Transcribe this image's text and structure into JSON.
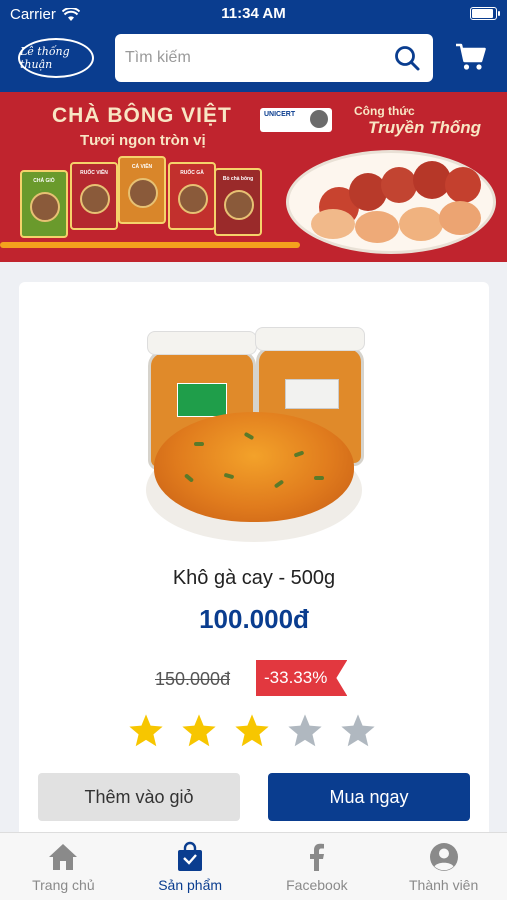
{
  "status_bar": {
    "carrier": "Carrier",
    "time": "11:34 AM",
    "battery_level": 0.95
  },
  "header": {
    "logo_text": "Lê thống thuận",
    "search_placeholder": "Tìm kiếm",
    "icons": {
      "search": "search-icon",
      "cart": "cart-icon"
    }
  },
  "banner": {
    "title": "CHÀ BÔNG VIỆT",
    "subtitle": "Tươi ngon tròn vị",
    "cert_label": "UNICERT",
    "tagline_top": "Công thức",
    "tagline_main": "Truyền Thống",
    "packs": [
      "CHẢ GIÒ",
      "RUỐC VIÊN",
      "CÁ VIÊN",
      "RUỐC GÀ",
      "Bò chà bông"
    ]
  },
  "product": {
    "name": "Khô gà cay - 500g",
    "price": "100.000đ",
    "old_price": "150.000đ",
    "discount": "-33.33%",
    "rating": 3,
    "rating_max": 5,
    "add_to_cart_label": "Thêm vào giỏ",
    "buy_now_label": "Mua ngay"
  },
  "colors": {
    "primary": "#0a3d8f",
    "discount": "#e2383f",
    "star_on": "#f7c600",
    "star_off": "#b0b8c0"
  },
  "tabs": [
    {
      "label": "Trang chủ",
      "icon": "home-icon",
      "active": false
    },
    {
      "label": "Sản phẩm",
      "icon": "shopping-bag-icon",
      "active": true
    },
    {
      "label": "Facebook",
      "icon": "facebook-icon",
      "active": false
    },
    {
      "label": "Thành viên",
      "icon": "user-icon",
      "active": false
    }
  ]
}
